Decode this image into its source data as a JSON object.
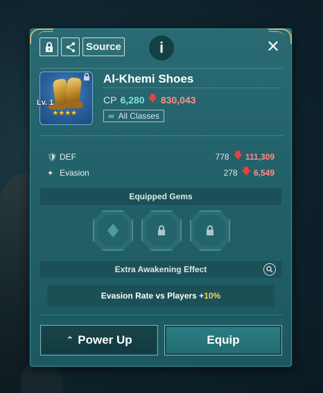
{
  "toolbar": {
    "lock_icon": "lock-icon",
    "share_icon": "share-icon",
    "source_label": "Source",
    "info_label": "i",
    "close_label": "✕"
  },
  "item": {
    "name": "Al-Khemi Shoes",
    "level": "Lv. 1",
    "stars": "★★★★",
    "cp_label": "CP",
    "cp_value": "6,280",
    "cp_diff": "830,043",
    "class_symbol": "∞",
    "class_label": "All Classes"
  },
  "stats": [
    {
      "name": "DEF",
      "value": "778",
      "diff": "111,309"
    },
    {
      "name": "Evasion",
      "value": "278",
      "diff": "6,549"
    }
  ],
  "gems": {
    "header": "Equipped Gems",
    "slots": [
      "open",
      "locked",
      "locked"
    ]
  },
  "awakening": {
    "header": "Extra Awakening Effect",
    "effect_prefix": "Evasion Rate vs Players +",
    "effect_value": "10%"
  },
  "buttons": {
    "power_up": "Power Up",
    "equip": "Equip"
  },
  "colors": {
    "panel": "#216068",
    "increase": "#7fe3d0",
    "decrease": "#ff8f85",
    "highlight": "#f2d45a"
  }
}
